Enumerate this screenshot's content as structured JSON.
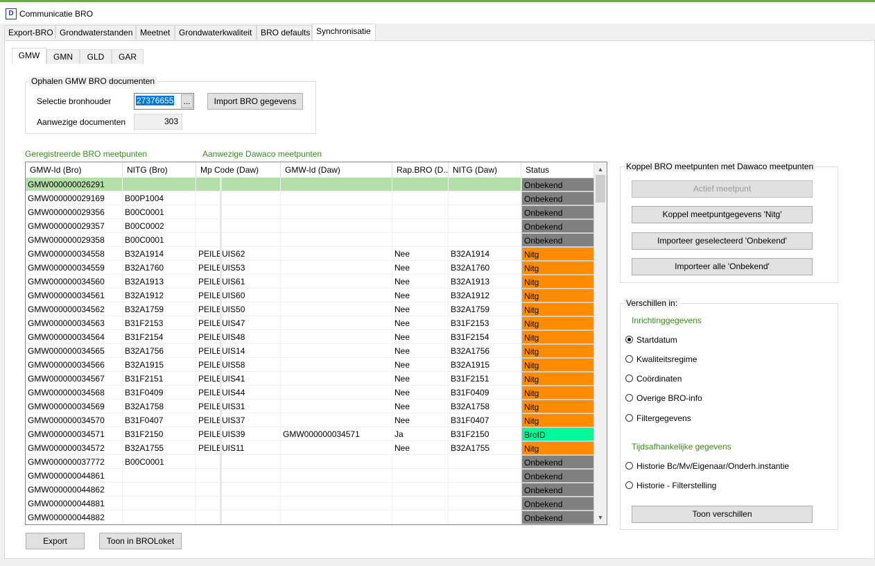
{
  "window": {
    "title": "Communicatie BRO",
    "icon_letter": "D"
  },
  "main_tabs": [
    "Export-BRO",
    "Grondwaterstanden",
    "Meetnet",
    "Grondwaterkwaliteit",
    "BRO defaults",
    "Synchronisatie"
  ],
  "sub_tabs": [
    "GMW",
    "GMN",
    "GLD",
    "GAR"
  ],
  "fetch": {
    "group_title": "Ophalen GMW BRO documenten",
    "selectie_label": "Selectie bronhouder",
    "selectie_value": "27376655",
    "browse_label": "...",
    "import_button": "Import BRO gegevens",
    "aanwezige_label": "Aanwezige documenten",
    "aanwezige_value": "303"
  },
  "grid_labels": {
    "left": "Geregistreerde BRO meetpunten",
    "right": "Aanwezige Dawaco meetpunten"
  },
  "columns": [
    "GMW-Id (Bro)",
    "NITG (Bro)",
    "Mp Code (Daw)",
    "GMW-Id (Daw)",
    "Rap.BRO (D...",
    "NITG (Daw)",
    "Status"
  ],
  "status_colors": {
    "Onbekend": "#808080",
    "Nitg": "#ff8c00",
    "BroID": "#00fa9a"
  },
  "rows": [
    {
      "id": "GMW000000026291",
      "nitg": "",
      "mp": "",
      "gmw_daw": "",
      "rap": "",
      "nitg_daw": "",
      "status": "Onbekend"
    },
    {
      "id": "GMW000000029169",
      "nitg": "B00P1004",
      "mp": "",
      "gmw_daw": "",
      "rap": "",
      "nitg_daw": "",
      "status": "Onbekend"
    },
    {
      "id": "GMW000000029356",
      "nitg": "B00C0001",
      "mp": "",
      "gmw_daw": "",
      "rap": "",
      "nitg_daw": "",
      "status": "Onbekend"
    },
    {
      "id": "GMW000000029357",
      "nitg": "B00C0002",
      "mp": "",
      "gmw_daw": "",
      "rap": "",
      "nitg_daw": "",
      "status": "Onbekend"
    },
    {
      "id": "GMW000000029358",
      "nitg": "B00C0001",
      "mp": "",
      "gmw_daw": "",
      "rap": "",
      "nitg_daw": "",
      "status": "Onbekend"
    },
    {
      "id": "GMW000000034558",
      "nitg": "B32A1914",
      "mp": "PEILBUIS62",
      "gmw_daw": "",
      "rap": "Nee",
      "nitg_daw": "B32A1914",
      "status": "Nitg"
    },
    {
      "id": "GMW000000034559",
      "nitg": "B32A1760",
      "mp": "PEILBUIS53",
      "gmw_daw": "",
      "rap": "Nee",
      "nitg_daw": "B32A1760",
      "status": "Nitg"
    },
    {
      "id": "GMW000000034560",
      "nitg": "B32A1913",
      "mp": "PEILBUIS61",
      "gmw_daw": "",
      "rap": "Nee",
      "nitg_daw": "B32A1913",
      "status": "Nitg"
    },
    {
      "id": "GMW000000034561",
      "nitg": "B32A1912",
      "mp": "PEILBUIS60",
      "gmw_daw": "",
      "rap": "Nee",
      "nitg_daw": "B32A1912",
      "status": "Nitg"
    },
    {
      "id": "GMW000000034562",
      "nitg": "B32A1759",
      "mp": "PEILBUIS50",
      "gmw_daw": "",
      "rap": "Nee",
      "nitg_daw": "B32A1759",
      "status": "Nitg"
    },
    {
      "id": "GMW000000034563",
      "nitg": "B31F2153",
      "mp": "PEILBUIS47",
      "gmw_daw": "",
      "rap": "Nee",
      "nitg_daw": "B31F2153",
      "status": "Nitg"
    },
    {
      "id": "GMW000000034564",
      "nitg": "B31F2154",
      "mp": "PEILBUIS48",
      "gmw_daw": "",
      "rap": "Nee",
      "nitg_daw": "B31F2154",
      "status": "Nitg"
    },
    {
      "id": "GMW000000034565",
      "nitg": "B32A1756",
      "mp": "PEILBUIS14",
      "gmw_daw": "",
      "rap": "Nee",
      "nitg_daw": "B32A1756",
      "status": "Nitg"
    },
    {
      "id": "GMW000000034566",
      "nitg": "B32A1915",
      "mp": "PEILBUIS58",
      "gmw_daw": "",
      "rap": "Nee",
      "nitg_daw": "B32A1915",
      "status": "Nitg"
    },
    {
      "id": "GMW000000034567",
      "nitg": "B31F2151",
      "mp": "PEILBUIS41",
      "gmw_daw": "",
      "rap": "Nee",
      "nitg_daw": "B31F2151",
      "status": "Nitg"
    },
    {
      "id": "GMW000000034568",
      "nitg": "B31F0409",
      "mp": "PEILBUIS44",
      "gmw_daw": "",
      "rap": "Nee",
      "nitg_daw": "B31F0409",
      "status": "Nitg"
    },
    {
      "id": "GMW000000034569",
      "nitg": "B32A1758",
      "mp": "PEILBUIS31",
      "gmw_daw": "",
      "rap": "Nee",
      "nitg_daw": "B32A1758",
      "status": "Nitg"
    },
    {
      "id": "GMW000000034570",
      "nitg": "B31F0407",
      "mp": "PEILBUIS37",
      "gmw_daw": "",
      "rap": "Nee",
      "nitg_daw": "B31F0407",
      "status": "Nitg"
    },
    {
      "id": "GMW000000034571",
      "nitg": "B31F2150",
      "mp": "PEILBUIS39",
      "gmw_daw": "GMW000000034571",
      "rap": "Ja",
      "nitg_daw": "B31F2150",
      "status": "BroID"
    },
    {
      "id": "GMW000000034572",
      "nitg": "B32A1755",
      "mp": "PEILBUIS11",
      "gmw_daw": "",
      "rap": "Nee",
      "nitg_daw": "B32A1755",
      "status": "Nitg"
    },
    {
      "id": "GMW000000037772",
      "nitg": "B00C0001",
      "mp": "",
      "gmw_daw": "",
      "rap": "",
      "nitg_daw": "",
      "status": "Onbekend"
    },
    {
      "id": "GMW000000044861",
      "nitg": "",
      "mp": "",
      "gmw_daw": "",
      "rap": "",
      "nitg_daw": "",
      "status": "Onbekend"
    },
    {
      "id": "GMW000000044862",
      "nitg": "",
      "mp": "",
      "gmw_daw": "",
      "rap": "",
      "nitg_daw": "",
      "status": "Onbekend"
    },
    {
      "id": "GMW000000044881",
      "nitg": "",
      "mp": "",
      "gmw_daw": "",
      "rap": "",
      "nitg_daw": "",
      "status": "Onbekend"
    },
    {
      "id": "GMW000000044882",
      "nitg": "",
      "mp": "",
      "gmw_daw": "",
      "rap": "",
      "nitg_daw": "",
      "status": "Onbekend"
    }
  ],
  "bottom_buttons": {
    "export": "Export",
    "broloket": "Toon in BROLoket"
  },
  "koppel": {
    "title": "Koppel BRO meetpunten met Dawaco meetpunten",
    "actief": "Actief meetpunt",
    "koppel_nitg": "Koppel meetpuntgegevens 'Nitg'",
    "import_sel": "Importeer geselecteerd 'Onbekend'",
    "import_all": "Importeer alle 'Onbekend'"
  },
  "verschillen": {
    "title": "Verschillen in:",
    "section1": "Inrichtinggegevens",
    "options1": [
      "Startdatum",
      "Kwaliteitsregime",
      "Coördinaten",
      "Overige BRO-info",
      "Filtergegevens"
    ],
    "selected": "Startdatum",
    "section2": "Tijdsafhankelijke gegevens",
    "options2": [
      "Historie Bc/Mv/Eigenaar/Onderh.instantie",
      "Historie - Filterstelling"
    ],
    "button": "Toon verschillen"
  }
}
